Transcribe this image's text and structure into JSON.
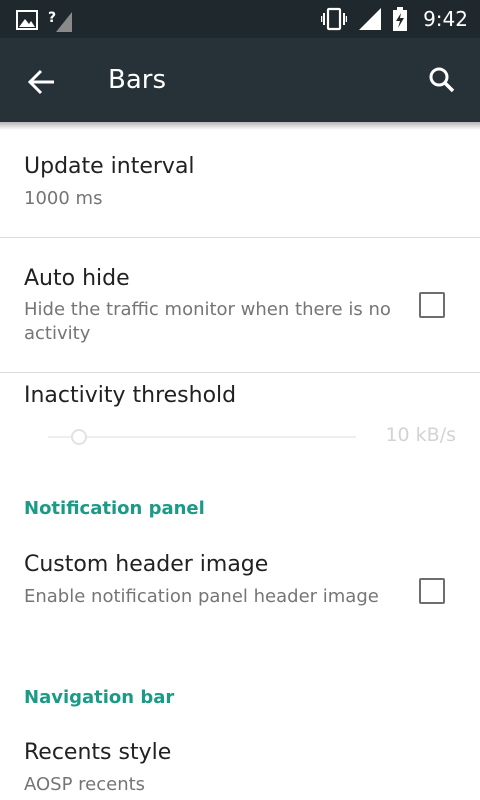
{
  "status_bar": {
    "time": "9:42",
    "icons": [
      "image-notification-icon",
      "no-signal-icon",
      "vibrate-icon",
      "signal-icon",
      "battery-charging-icon"
    ]
  },
  "toolbar": {
    "title": "Bars",
    "back_icon": "back-arrow-icon",
    "search_icon": "search-icon"
  },
  "prefs": {
    "update_interval": {
      "title": "Update interval",
      "summary": "1000 ms"
    },
    "auto_hide": {
      "title": "Auto hide",
      "summary": "Hide the traffic monitor when there is no activity",
      "checked": false
    },
    "inactivity_threshold": {
      "title": "Inactivity threshold",
      "value": "10 kB/s",
      "level": 0.1
    }
  },
  "notification_panel": {
    "category": "Notification panel",
    "custom_header": {
      "title": "Custom header image",
      "summary": "Enable notification panel header image",
      "checked": false
    }
  },
  "navigation_bar": {
    "category": "Navigation bar",
    "recents_style": {
      "title": "Recents style",
      "summary": "AOSP recents"
    }
  },
  "colors": {
    "status_bar": "#1f282c",
    "toolbar": "#263238",
    "accent": "#1b9a86"
  }
}
